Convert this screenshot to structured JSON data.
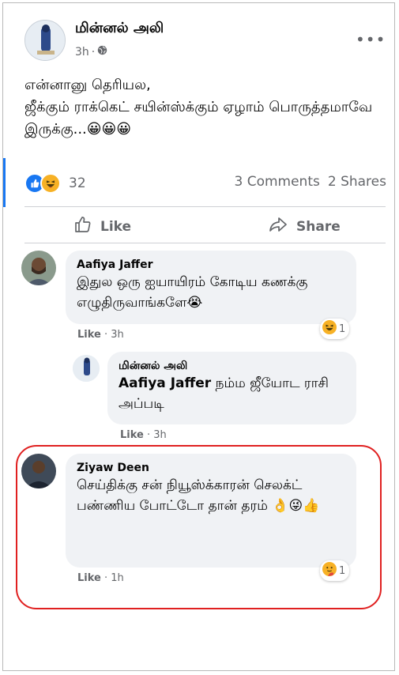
{
  "post": {
    "author": "மின்னல் அலி",
    "time": "3h",
    "separator": "·",
    "privacy_icon": "globe-icon",
    "more_icon": "more-icon",
    "more": "•••",
    "text": "என்னானு தெரியல,\nஜீக்கும் ராக்கெட் சயின்ஸ்க்கும் ஏழாம் பொருத்தமாவே இருக்கு...😀😀😀"
  },
  "reactions": {
    "types": [
      "like",
      "haha"
    ],
    "count": "32",
    "comments": "3 Comments",
    "shares": "2 Shares"
  },
  "actions": {
    "like_label": "Like",
    "share_label": "Share"
  },
  "comments": [
    {
      "author": "Aafiya Jaffer",
      "text": "இதுல ஒரு ஐயாயிரம் கோடிய கணக்கு எழுதிருவாங்களே😭",
      "like": "Like",
      "time": "3h",
      "reaction_count": "1"
    },
    {
      "author": "மின்னல் அலி",
      "mention": "Aafiya Jaffer",
      "text": " நம்ம ஜீயோட ராசி அப்படி",
      "like": "Like",
      "time": "3h"
    },
    {
      "author": "Ziyaw Deen",
      "text": "செய்திக்கு சன் நியூஸ்க்காரன் செலக்ட் பண்ணிய போட்டோ தான் தரம் 👌😜👍",
      "like": "Like",
      "time": "1h",
      "reaction_count": "1"
    }
  ],
  "colors": {
    "accent": "#1877f2",
    "highlight": "#e02020",
    "bubble": "#f0f2f5"
  }
}
